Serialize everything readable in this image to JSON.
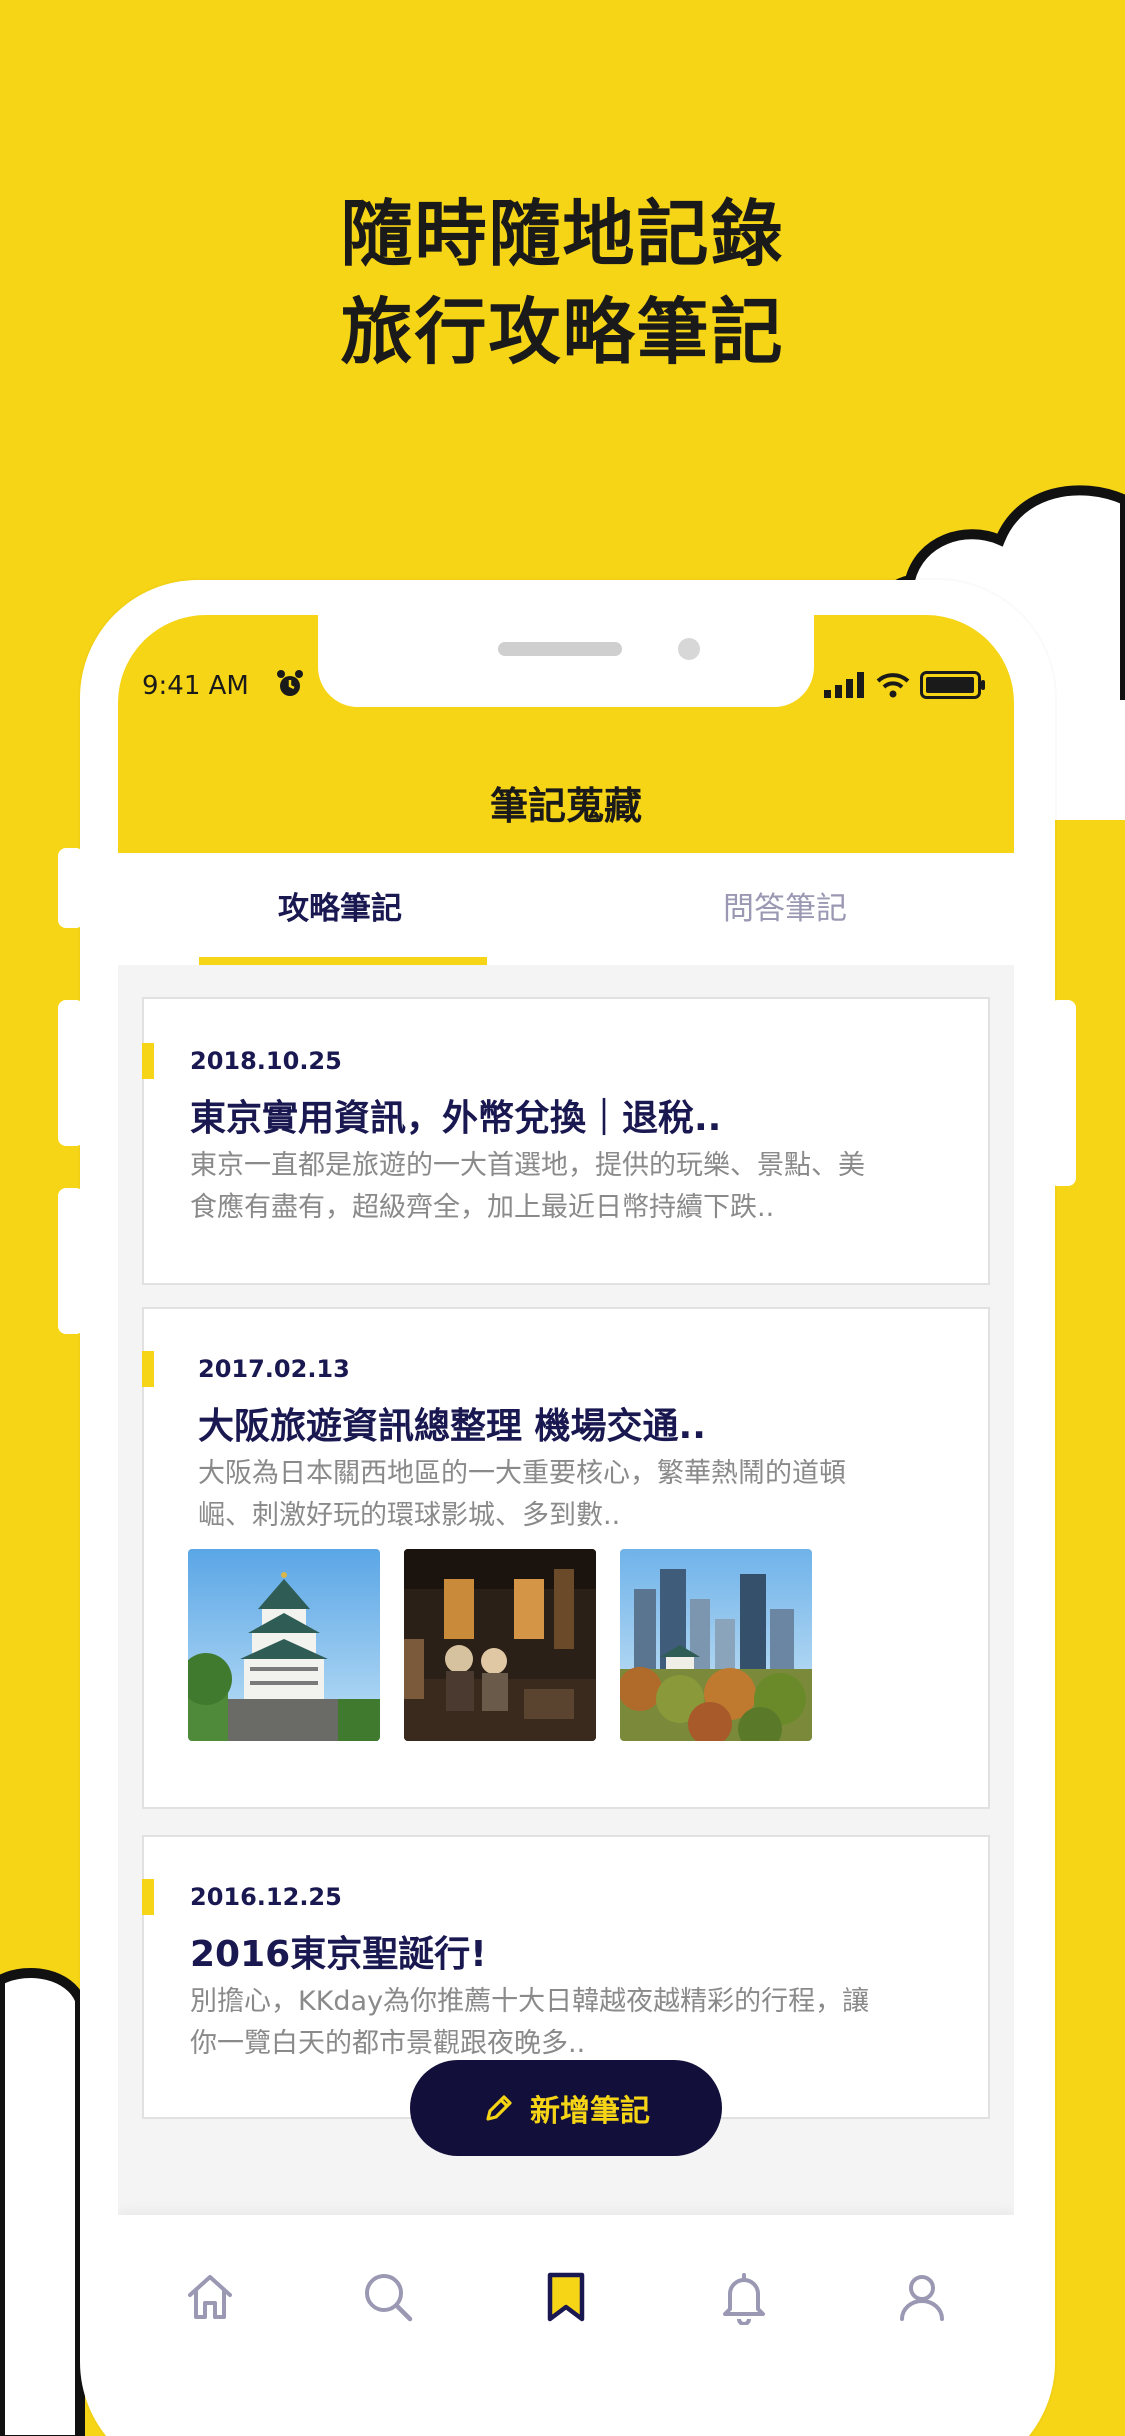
{
  "headline": {
    "line1": "隨時隨地記錄",
    "line2": "旅行攻略筆記"
  },
  "status_bar": {
    "time": "9:41 AM",
    "icons": [
      "alarm-icon",
      "signal-icon",
      "wifi-icon",
      "battery-icon"
    ]
  },
  "header": {
    "title": "筆記蒐藏"
  },
  "tabs": [
    {
      "label": "攻略筆記",
      "active": true
    },
    {
      "label": "問答筆記",
      "active": false
    }
  ],
  "notes": [
    {
      "date": "2018.10.25",
      "title": "東京實用資訊，外幣兌換｜退稅..",
      "desc_line1": "東京一直都是旅遊的一大首選地，提供的玩樂、景點、美",
      "desc_line2": "食應有盡有，超級齊全，加上最近日幣持續下跌.."
    },
    {
      "date": "2017.02.13",
      "title": "大阪旅遊資訊總整理 機場交通..",
      "desc_line1": "大阪為日本關西地區的一大重要核心，繁華熱鬧的道頓",
      "desc_line2": "崛、刺激好玩的環球影城、多到數..",
      "images": [
        "osaka-castle-photo",
        "street-food-stall-photo",
        "osaka-skyline-photo"
      ]
    },
    {
      "date": "2016.12.25",
      "title": "2016東京聖誕行!",
      "desc_line1": "別擔心，KKday為你推薦十大日韓越夜越精彩的行程，讓",
      "desc_line2": "你一覽白天的都市景觀跟夜晚多.."
    }
  ],
  "fab": {
    "label": "新增筆記",
    "icon": "pencil-icon"
  },
  "tabbar": {
    "items": [
      "home-icon",
      "search-icon",
      "bookmark-icon",
      "bell-icon",
      "profile-icon"
    ],
    "active_index": 2
  },
  "colors": {
    "brand_yellow": "#f6d516",
    "navy": "#1a1850",
    "fab_bg": "#12103a",
    "muted_text": "#8a8a8a"
  }
}
